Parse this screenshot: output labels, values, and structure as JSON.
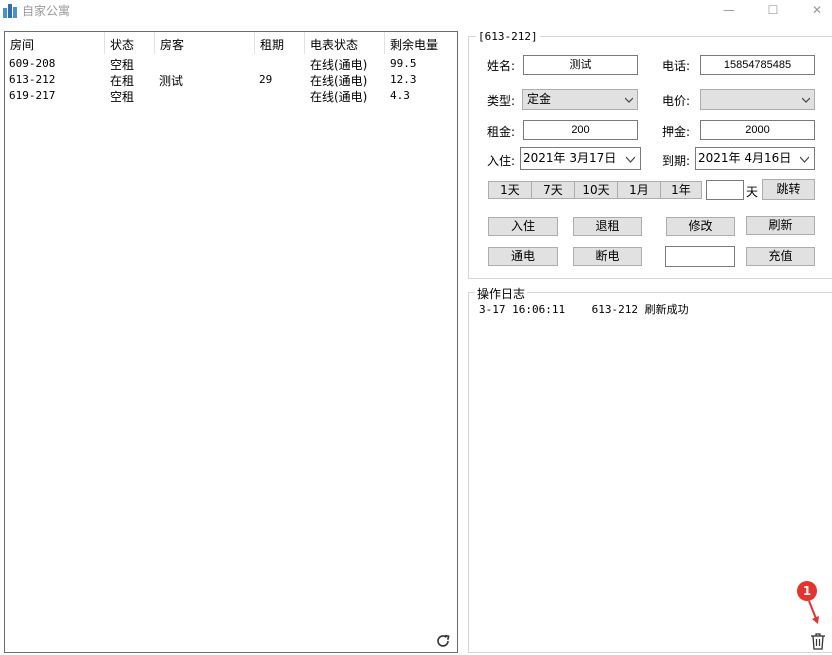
{
  "window": {
    "title": "自家公寓",
    "controls": {
      "minimize": "—",
      "maximize": "☐",
      "close": "✕"
    }
  },
  "room_list": {
    "columns": [
      "房间",
      "状态",
      "房客",
      "租期",
      "电表状态",
      "剩余电量"
    ],
    "rows": [
      [
        "609-208",
        "空租",
        "",
        "",
        "在线(通电)",
        "99.5"
      ],
      [
        "613-212",
        "在租",
        "测试",
        "29",
        "在线(通电)",
        "12.3"
      ],
      [
        "619-217",
        "空租",
        "",
        "",
        "在线(通电)",
        "4.3"
      ]
    ]
  },
  "detail": {
    "legend": "[613-212]",
    "name_label": "姓名:",
    "name_value": "测试",
    "phone_label": "电话:",
    "phone_value": "15854785485",
    "type_label": "类型:",
    "type_value": "定金",
    "price_label": "电价:",
    "price_value": "",
    "rent_label": "租金:",
    "rent_value": "200",
    "deposit_label": "押金:",
    "deposit_value": "2000",
    "checkin_label": "入住:",
    "checkin_value": "2021年  3月17日",
    "expire_label": "到期:",
    "expire_value": "2021年  4月16日",
    "quick": [
      "1天",
      "7天",
      "10天",
      "1月",
      "1年"
    ],
    "days_value": "",
    "days_unit": "天",
    "jump_label": "跳转",
    "btn_checkin": "入住",
    "btn_checkout": "退租",
    "btn_modify": "修改",
    "btn_refresh": "刷新",
    "btn_power_on": "通电",
    "btn_power_off": "断电",
    "recharge_value": "",
    "btn_recharge": "充值"
  },
  "log": {
    "legend": "操作日志",
    "entries": [
      "3-17 16:06:11    613-212 刷新成功"
    ]
  },
  "badge": {
    "count": "1",
    "color": "#e8322c"
  }
}
